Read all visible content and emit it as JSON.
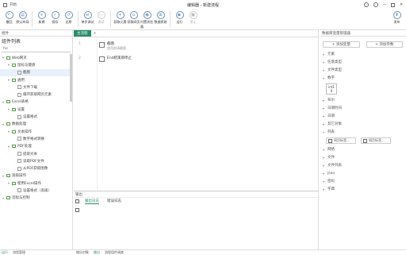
{
  "titlebar": {
    "menu_label": "开始",
    "title": "编辑器 - 新建流程"
  },
  "toolbar": {
    "buttons": [
      {
        "label": "撤回",
        "glyph": "↶"
      },
      {
        "label": "默认布局",
        "glyph": "▤"
      },
      {
        "label": "新建",
        "glyph": "+"
      },
      {
        "label": "保存",
        "glyph": "✓"
      },
      {
        "label": "还原",
        "glyph": "↺"
      },
      {
        "label": "单步调试",
        "glyph": "⏯"
      },
      {
        "label": "调试",
        "glyph": "▷"
      },
      {
        "label": "获取元素",
        "glyph": "⌖"
      },
      {
        "label": "获取网页",
        "glyph": "⌂"
      },
      {
        "label": "内置浏览器",
        "glyph": "◉"
      },
      {
        "label": "数据抓取",
        "glyph": "⊞"
      },
      {
        "label": "运行",
        "glyph": "▶"
      },
      {
        "label": "停止",
        "glyph": "■"
      },
      {
        "label": "发布",
        "glyph": "⬆"
      }
    ]
  },
  "left": {
    "header": "组件",
    "title": "组件列表",
    "search_value": "fsc",
    "items": [
      {
        "label": "Web网页",
        "level": 0,
        "type": "folder"
      },
      {
        "label": "鼠标与键盘",
        "level": 1,
        "type": "folder"
      },
      {
        "label": "截图",
        "level": 2,
        "type": "item",
        "selected": true
      },
      {
        "label": "通用",
        "level": 1,
        "type": "folder"
      },
      {
        "label": "文件下载",
        "level": 2,
        "type": "item"
      },
      {
        "label": "循环获取网页元素",
        "level": 2,
        "type": "item"
      },
      {
        "label": "Excel表格",
        "level": 0,
        "type": "folder"
      },
      {
        "label": "设置",
        "level": 1,
        "type": "folder"
      },
      {
        "label": "设置格式",
        "level": 2,
        "type": "item"
      },
      {
        "label": "数据处理",
        "level": 0,
        "type": "folder"
      },
      {
        "label": "文本操作",
        "level": 1,
        "type": "folder"
      },
      {
        "label": "数字格式转换",
        "level": 2,
        "type": "item"
      },
      {
        "label": "PDF处理",
        "level": 1,
        "type": "folder"
      },
      {
        "label": "提取文本",
        "level": 2,
        "type": "item"
      },
      {
        "label": "读取PDF文件",
        "level": 2,
        "type": "item"
      },
      {
        "label": "从PDF获取图像",
        "level": 2,
        "type": "item"
      },
      {
        "label": "高级操作",
        "level": 0,
        "type": "folder"
      },
      {
        "label": "使用Excel操作",
        "level": 1,
        "type": "folder"
      },
      {
        "label": "设置格式（高级）",
        "level": 2,
        "type": "item"
      },
      {
        "label": "流程与控制",
        "level": 0,
        "type": "folder"
      }
    ]
  },
  "editor": {
    "tab": "主流程",
    "steps": [
      {
        "line": "1",
        "title": "截图",
        "subtitle": "使用前请截图"
      },
      {
        "line": "2",
        "title": "End结束即停止",
        "subtitle": ""
      }
    ]
  },
  "bottom": {
    "header": "输出",
    "tabs": [
      "输出日志",
      "错误日志"
    ]
  },
  "right": {
    "header": "数据库变量管理器",
    "add_var": "添加变量",
    "add_param": "添加参数",
    "sections": [
      "元素",
      "任意类型",
      "文件类型",
      "数字",
      "布尔",
      "日期时间",
      "日期",
      "其它对象",
      "列表",
      "网络",
      "文件",
      "文件列表",
      "Json",
      "密码",
      "字典"
    ],
    "var_tile": {
      "name": "int1",
      "value": "0"
    },
    "cards": [
      "网页标签…",
      "网页标签…"
    ]
  },
  "status": {
    "left": "运行",
    "left2": "流程管理",
    "mid1": "输出对象",
    "mid2": "输出",
    "mid3": "流程组件调度"
  }
}
